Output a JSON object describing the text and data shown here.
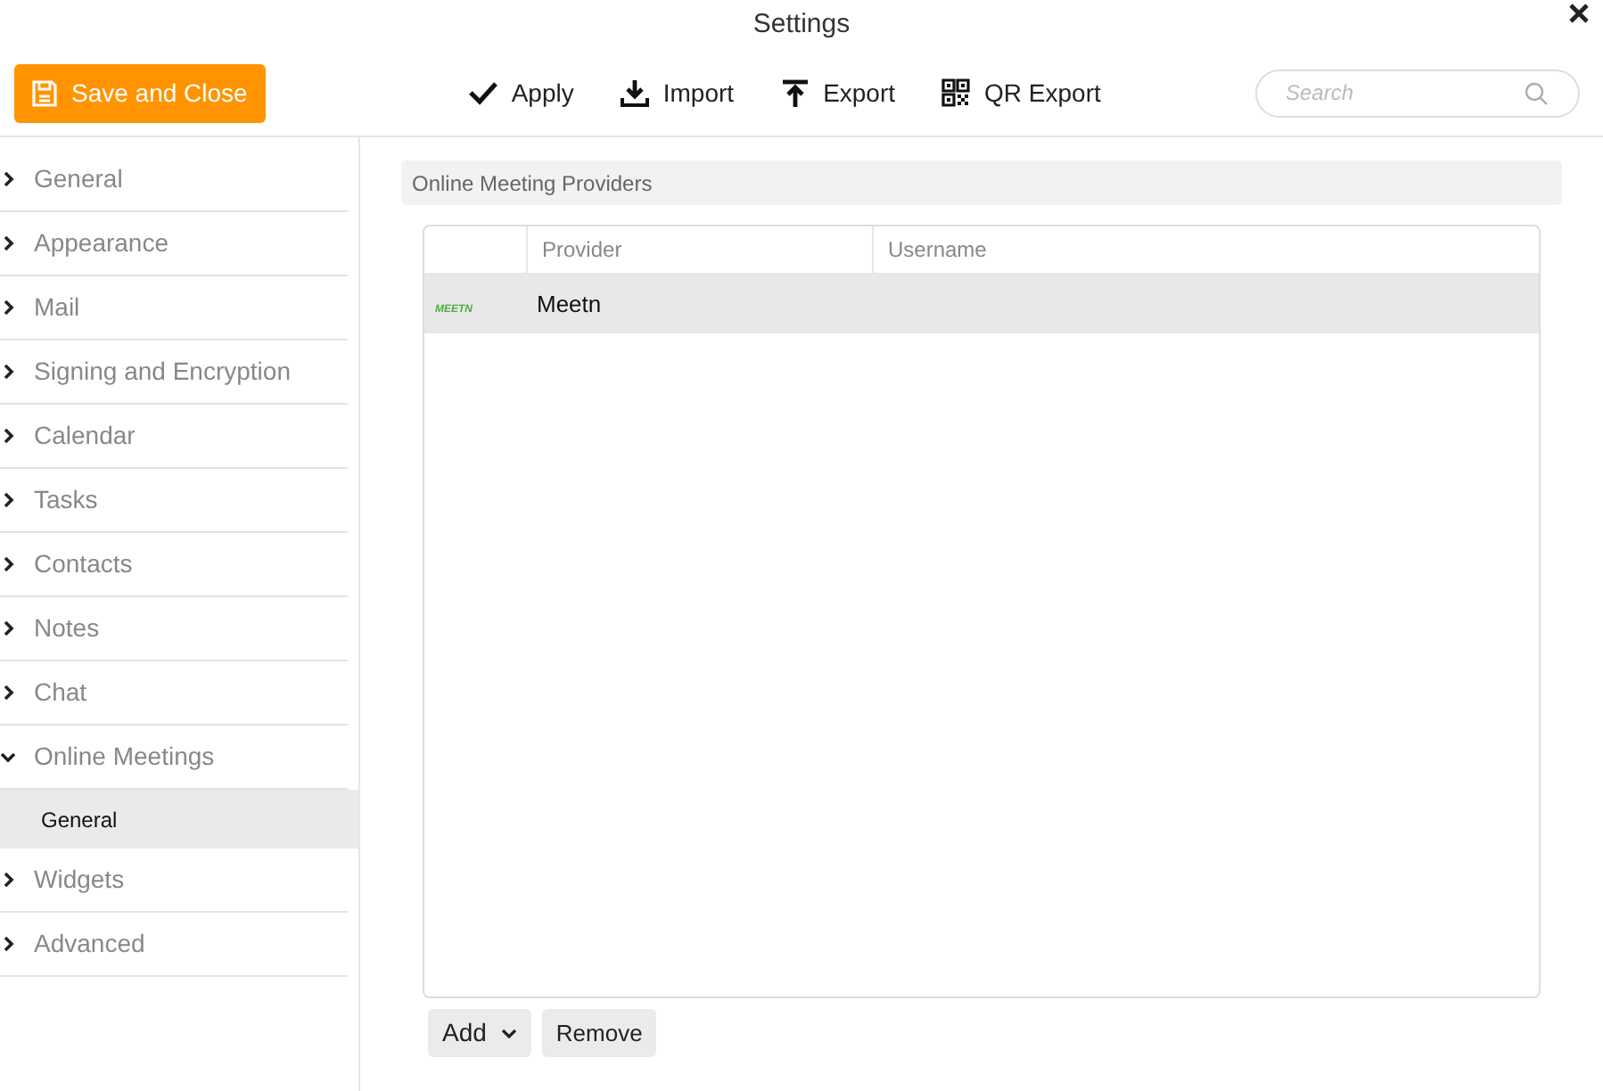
{
  "window": {
    "title": "Settings"
  },
  "toolbar": {
    "save_button": "Save and Close",
    "actions": [
      {
        "kind": "apply",
        "label": "Apply"
      },
      {
        "kind": "import",
        "label": "Import"
      },
      {
        "kind": "export",
        "label": "Export"
      },
      {
        "kind": "qr",
        "label": "QR Export"
      }
    ],
    "search": {
      "placeholder": "Search"
    }
  },
  "sidebar": {
    "items": [
      {
        "label": "General",
        "expanded": false
      },
      {
        "label": "Appearance",
        "expanded": false
      },
      {
        "label": "Mail",
        "expanded": false
      },
      {
        "label": "Signing and Encryption",
        "expanded": false
      },
      {
        "label": "Calendar",
        "expanded": false
      },
      {
        "label": "Tasks",
        "expanded": false
      },
      {
        "label": "Contacts",
        "expanded": false
      },
      {
        "label": "Notes",
        "expanded": false
      },
      {
        "label": "Chat",
        "expanded": false
      },
      {
        "label": "Online Meetings",
        "expanded": true,
        "children": [
          {
            "label": "General",
            "selected": true
          }
        ]
      },
      {
        "label": "Widgets",
        "expanded": false
      },
      {
        "label": "Advanced",
        "expanded": false
      }
    ]
  },
  "section": {
    "title": "Online Meeting Providers"
  },
  "table": {
    "columns": [
      "Provider",
      "Username"
    ],
    "rows": [
      {
        "logo": "MEETN",
        "provider": "Meetn",
        "selected": true
      }
    ]
  },
  "buttons": {
    "add": "Add",
    "remove": "Remove"
  }
}
